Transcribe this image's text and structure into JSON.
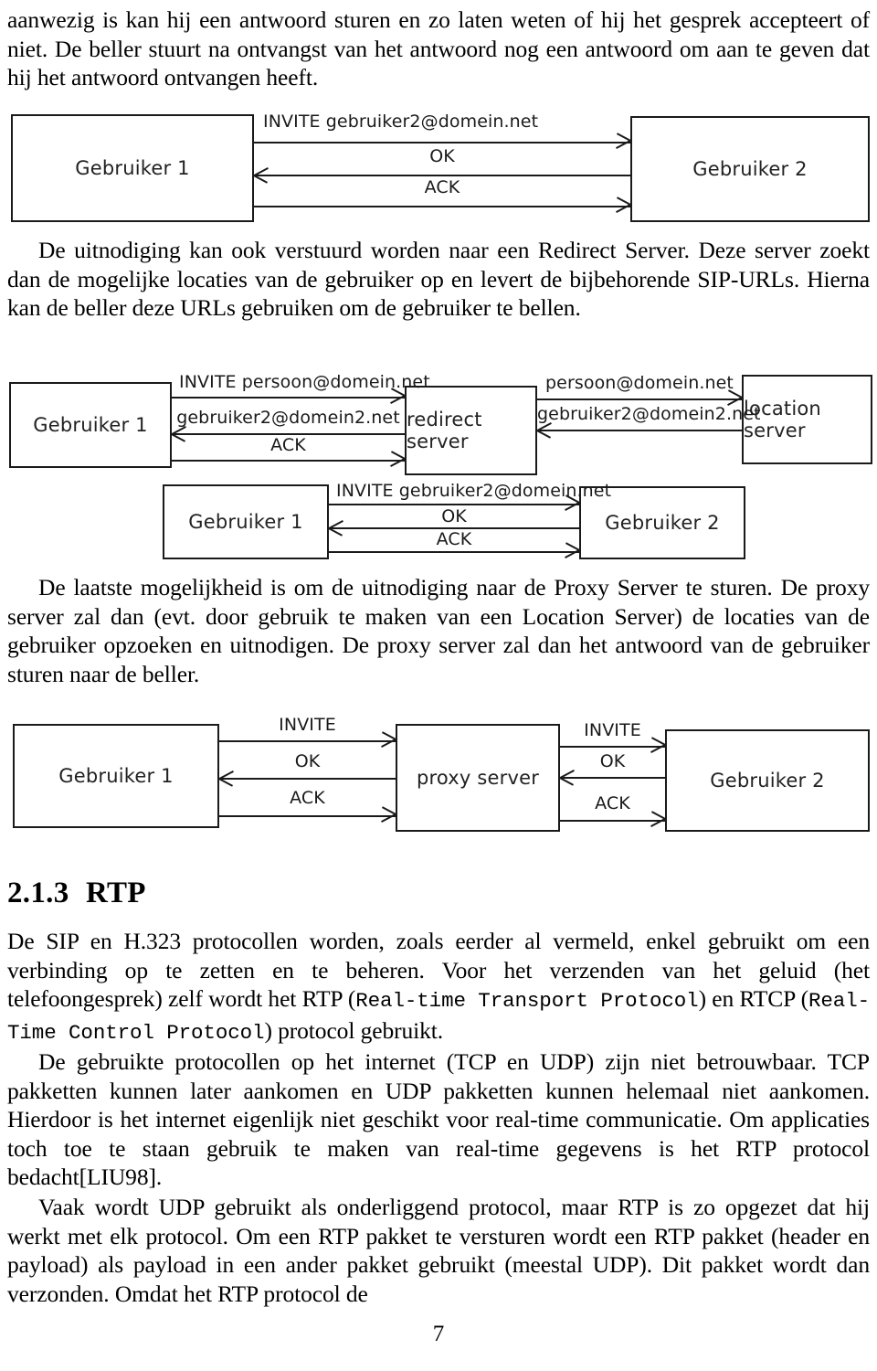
{
  "document": {
    "page_number": "7",
    "language": "nl"
  },
  "top_paragraph": "aanwezig is kan hij een antwoord sturen en zo laten weten of hij het gesprek accepteert of niet.  De beller stuurt na ontvangst van het antwoord nog een antwoord om aan te geven dat hij het antwoord ontvangen heeft.",
  "paragraph_redirect": "De uitnodiging kan ook verstuurd worden naar een Redirect Server.  Deze server zoekt dan de mogelijke locaties van de gebruiker op en levert de bijbehorende SIP-URLs. Hierna kan de beller deze URLs gebruiken om de gebruiker te bellen.",
  "paragraph_proxy": "De laatste mogelijkheid is om de uitnodiging naar de Proxy Server te sturen. De proxy server zal dan (evt. door gebruik te maken van een Location Server) de locaties van de gebruiker opzoeken en uitnodigen.  De proxy server zal dan het antwoord van de gebruiker sturen naar de beller.",
  "section": {
    "number": "2.1.3",
    "title": "RTP"
  },
  "rtp_paragraph_1": {
    "part1": "De SIP en H.323 protocollen worden, zoals eerder al vermeld, enkel gebruikt om een verbinding op te zetten en te beheren.  Voor het verzenden van het geluid (het telefoongesprek) zelf wordt het RTP (",
    "mono1": "Real-time Transport Protocol",
    "part2": ") en RTCP (",
    "mono2": "Real-Time Control Protocol",
    "part3": ") protocol gebruikt."
  },
  "rtp_paragraph_2": "De gebruikte protocollen op het internet (TCP en UDP) zijn niet betrouwbaar.  TCP pakketten kunnen later aankomen en UDP pakketten kunnen helemaal niet aankomen.  Hierdoor is het internet eigenlijk niet geschikt voor real-time communicatie. Om applicaties toch toe te staan gebruik te maken van real-time gegevens is het RTP protocol bedacht[LIU98].",
  "rtp_paragraph_3": "Vaak wordt UDP gebruikt als onderliggend protocol, maar RTP is zo opgezet dat hij werkt met elk protocol.  Om een RTP pakket te versturen wordt een RTP pakket (header en payload) als payload in een ander pakket gebruikt (meestal UDP). Dit pakket wordt dan verzonden. Omdat het RTP protocol de",
  "diagram_direct": {
    "nodes": {
      "left": "Gebruiker 1",
      "right": "Gebruiker 2"
    },
    "edges": [
      {
        "label": "INVITE gebruiker2@domein.net",
        "direction": "right"
      },
      {
        "label": "OK",
        "direction": "left"
      },
      {
        "label": "ACK",
        "direction": "right"
      }
    ]
  },
  "diagram_redirect": {
    "nodes": {
      "user1": "Gebruiker 1",
      "redirect": "redirect server",
      "location": "location server",
      "user1_row2": "Gebruiker 1",
      "user2_row2": "Gebruiker 2"
    },
    "edges_user1_redirect": [
      {
        "label": "INVITE persoon@domein.net",
        "direction": "right"
      },
      {
        "label": "gebruiker2@domein2.net",
        "direction": "left"
      },
      {
        "label": "ACK",
        "direction": "right"
      }
    ],
    "edges_redirect_location": [
      {
        "label": "persoon@domein.net",
        "direction": "right"
      },
      {
        "label": "gebruiker2@domein2.net",
        "direction": "left"
      }
    ],
    "edges_row2": [
      {
        "label": "INVITE gebruiker2@domein.net",
        "direction": "right"
      },
      {
        "label": "OK",
        "direction": "left"
      },
      {
        "label": "ACK",
        "direction": "right"
      }
    ]
  },
  "diagram_proxy": {
    "nodes": {
      "left": "Gebruiker 1",
      "middle": "proxy server",
      "right": "Gebruiker 2"
    },
    "edges_left": [
      {
        "label": "INVITE",
        "direction": "right"
      },
      {
        "label": "OK",
        "direction": "left"
      },
      {
        "label": "ACK",
        "direction": "right"
      }
    ],
    "edges_right": [
      {
        "label": "INVITE",
        "direction": "right"
      },
      {
        "label": "OK",
        "direction": "left"
      },
      {
        "label": "ACK",
        "direction": "right"
      }
    ]
  },
  "colors": {
    "ink": "#1a1a1a",
    "page": "#ffffff"
  }
}
